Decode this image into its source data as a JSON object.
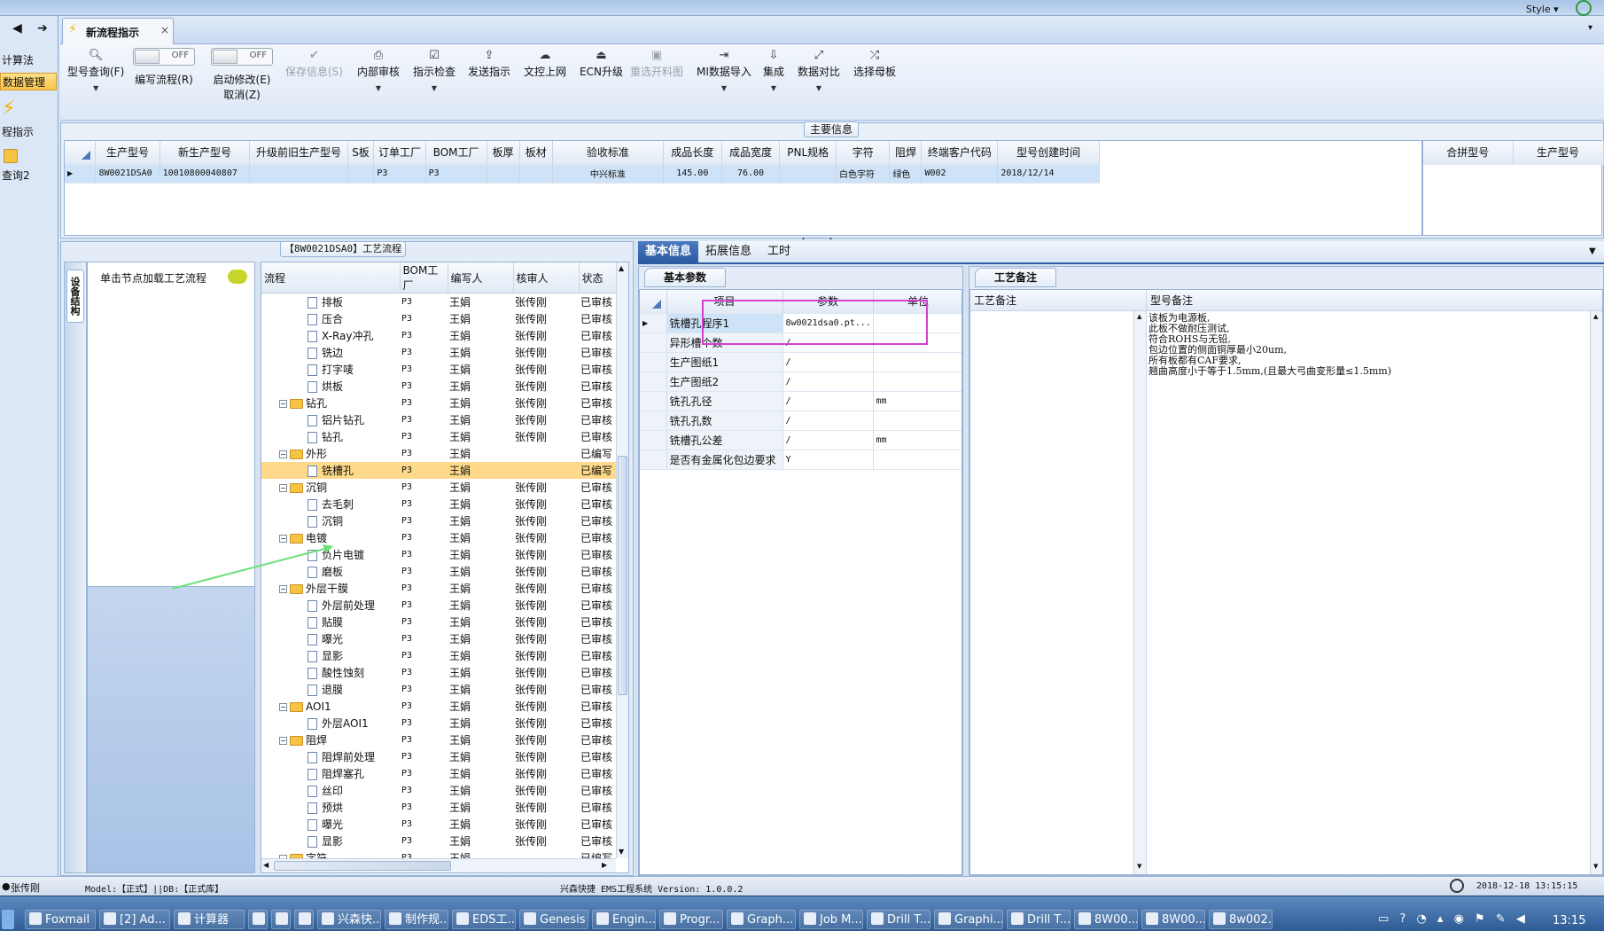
{
  "topbar": {
    "style_label": "Style ▾"
  },
  "left_nav": {
    "items": [
      {
        "label": "计算法",
        "selected": false
      },
      {
        "label": "数据管理",
        "selected": true
      },
      {
        "label": "程指示",
        "selected": false
      },
      {
        "label": "查询2",
        "selected": false
      }
    ]
  },
  "tabs": {
    "back_glyph": "◀",
    "forward_glyph": "➔",
    "active_label": "新流程指示",
    "close_glyph": "×",
    "menu_glyph": "▾"
  },
  "toolbar": {
    "buttons": [
      {
        "label": "型号查询(F)",
        "icon": "search-icon",
        "glyph": "🔍︎",
        "disabled": false,
        "dropdown": true
      },
      {
        "label": "编写流程(R)",
        "icon": "toggle-switch",
        "toggle": "OFF",
        "disabled": false
      },
      {
        "label": "启动修改(E)",
        "label2": "取消(Z)",
        "icon": "toggle-switch",
        "toggle": "OFF",
        "disabled": false
      },
      {
        "label": "保存信息(S)",
        "icon": "check-icon",
        "glyph": "✔",
        "disabled": true
      },
      {
        "label": "内部审核",
        "icon": "printer-icon",
        "glyph": "⎙",
        "disabled": false,
        "dropdown": true
      },
      {
        "label": "指示检查",
        "icon": "checkbox-icon",
        "glyph": "☑",
        "disabled": false,
        "dropdown": true
      },
      {
        "label": "发送指示",
        "icon": "upload-icon",
        "glyph": "⇪",
        "disabled": false
      },
      {
        "label": "文控上网",
        "icon": "cloud-icon",
        "glyph": "☁",
        "disabled": false
      },
      {
        "label": "ECN升级",
        "icon": "ecn-icon",
        "glyph": "⏏",
        "disabled": false
      },
      {
        "label": "重选开料图",
        "icon": "image-icon",
        "glyph": "▣",
        "disabled": true
      },
      {
        "label": "MI数据导入",
        "icon": "import-icon",
        "glyph": "⇥",
        "disabled": false,
        "dropdown": true
      },
      {
        "label": "集成",
        "icon": "download-icon",
        "glyph": "⇩",
        "disabled": false,
        "dropdown": true
      },
      {
        "label": "数据对比",
        "icon": "compare-icon",
        "glyph": "⤢",
        "disabled": false,
        "dropdown": true
      },
      {
        "label": "选择母板",
        "icon": "shuffle-icon",
        "glyph": "⤮",
        "disabled": false
      }
    ]
  },
  "main_info": {
    "section_title": "主要信息",
    "columns": [
      "生产型号",
      "新生产型号",
      "升级前旧生产型号",
      "S板",
      "订单工厂",
      "BOM工厂",
      "板厚",
      "板材",
      "验收标准",
      "成品长度",
      "成品宽度",
      "PNL规格",
      "字符",
      "阻焊",
      "终端客户代码",
      "型号创建时间"
    ],
    "rows": [
      [
        "8W0021DSA0",
        "10010800040807",
        "",
        "",
        "P3",
        "P3",
        "",
        "",
        "中兴标准",
        "145.00",
        "76.00",
        "",
        "白色字符",
        "绿色",
        "W002",
        "2018/12/14"
      ]
    ],
    "side_columns": [
      "合拼型号",
      "生产型号"
    ]
  },
  "process": {
    "section_title": "【8W0021DSA0】工艺流程",
    "side_tab_label": "设备结构",
    "hint": "单击节点加载工艺流程",
    "columns": [
      "流程",
      "BOM工厂",
      "编写人",
      "核审人",
      "状态"
    ],
    "rows": [
      {
        "name": "排板",
        "level": 2,
        "bom": "P3",
        "writer": "王娟",
        "reviewer": "张传刚",
        "status": "已审核"
      },
      {
        "name": "压合",
        "level": 2,
        "bom": "P3",
        "writer": "王娟",
        "reviewer": "张传刚",
        "status": "已审核"
      },
      {
        "name": "X-Ray冲孔",
        "level": 2,
        "bom": "P3",
        "writer": "王娟",
        "reviewer": "张传刚",
        "status": "已审核"
      },
      {
        "name": "铣边",
        "level": 2,
        "bom": "P3",
        "writer": "王娟",
        "reviewer": "张传刚",
        "status": "已审核"
      },
      {
        "name": "打字唛",
        "level": 2,
        "bom": "P3",
        "writer": "王娟",
        "reviewer": "张传刚",
        "status": "已审核"
      },
      {
        "name": "烘板",
        "level": 2,
        "bom": "P3",
        "writer": "王娟",
        "reviewer": "张传刚",
        "status": "已审核"
      },
      {
        "name": "钻孔",
        "level": 1,
        "bom": "P3",
        "writer": "王娟",
        "reviewer": "张传刚",
        "status": "已审核"
      },
      {
        "name": "铝片钻孔",
        "level": 2,
        "bom": "P3",
        "writer": "王娟",
        "reviewer": "张传刚",
        "status": "已审核"
      },
      {
        "name": "钻孔",
        "level": 2,
        "bom": "P3",
        "writer": "王娟",
        "reviewer": "张传刚",
        "status": "已审核"
      },
      {
        "name": "外形",
        "level": 1,
        "bom": "P3",
        "writer": "王娟",
        "reviewer": "",
        "status": "已编写"
      },
      {
        "name": "铣槽孔",
        "level": 2,
        "bom": "P3",
        "writer": "王娟",
        "reviewer": "",
        "status": "已编写",
        "selected": true
      },
      {
        "name": "沉铜",
        "level": 1,
        "bom": "P3",
        "writer": "王娟",
        "reviewer": "张传刚",
        "status": "已审核"
      },
      {
        "name": "去毛刺",
        "level": 2,
        "bom": "P3",
        "writer": "王娟",
        "reviewer": "张传刚",
        "status": "已审核"
      },
      {
        "name": "沉铜",
        "level": 2,
        "bom": "P3",
        "writer": "王娟",
        "reviewer": "张传刚",
        "status": "已审核"
      },
      {
        "name": "电镀",
        "level": 1,
        "bom": "P3",
        "writer": "王娟",
        "reviewer": "张传刚",
        "status": "已审核"
      },
      {
        "name": "负片电镀",
        "level": 2,
        "bom": "P3",
        "writer": "王娟",
        "reviewer": "张传刚",
        "status": "已审核"
      },
      {
        "name": "磨板",
        "level": 2,
        "bom": "P3",
        "writer": "王娟",
        "reviewer": "张传刚",
        "status": "已审核"
      },
      {
        "name": "外层干膜",
        "level": 1,
        "bom": "P3",
        "writer": "王娟",
        "reviewer": "张传刚",
        "status": "已审核"
      },
      {
        "name": "外层前处理",
        "level": 2,
        "bom": "P3",
        "writer": "王娟",
        "reviewer": "张传刚",
        "status": "已审核"
      },
      {
        "name": "贴膜",
        "level": 2,
        "bom": "P3",
        "writer": "王娟",
        "reviewer": "张传刚",
        "status": "已审核"
      },
      {
        "name": "曝光",
        "level": 2,
        "bom": "P3",
        "writer": "王娟",
        "reviewer": "张传刚",
        "status": "已审核"
      },
      {
        "name": "显影",
        "level": 2,
        "bom": "P3",
        "writer": "王娟",
        "reviewer": "张传刚",
        "status": "已审核"
      },
      {
        "name": "酸性蚀刻",
        "level": 2,
        "bom": "P3",
        "writer": "王娟",
        "reviewer": "张传刚",
        "status": "已审核"
      },
      {
        "name": "退膜",
        "level": 2,
        "bom": "P3",
        "writer": "王娟",
        "reviewer": "张传刚",
        "status": "已审核"
      },
      {
        "name": "AOI1",
        "level": 1,
        "bom": "P3",
        "writer": "王娟",
        "reviewer": "张传刚",
        "status": "已审核"
      },
      {
        "name": "外层AOI1",
        "level": 2,
        "bom": "P3",
        "writer": "王娟",
        "reviewer": "张传刚",
        "status": "已审核"
      },
      {
        "name": "阻焊",
        "level": 1,
        "bom": "P3",
        "writer": "王娟",
        "reviewer": "张传刚",
        "status": "已审核"
      },
      {
        "name": "阻焊前处理",
        "level": 2,
        "bom": "P3",
        "writer": "王娟",
        "reviewer": "张传刚",
        "status": "已审核"
      },
      {
        "name": "阻焊塞孔",
        "level": 2,
        "bom": "P3",
        "writer": "王娟",
        "reviewer": "张传刚",
        "status": "已审核"
      },
      {
        "name": "丝印",
        "level": 2,
        "bom": "P3",
        "writer": "王娟",
        "reviewer": "张传刚",
        "status": "已审核"
      },
      {
        "name": "预烘",
        "level": 2,
        "bom": "P3",
        "writer": "王娟",
        "reviewer": "张传刚",
        "status": "已审核"
      },
      {
        "name": "曝光",
        "level": 2,
        "bom": "P3",
        "writer": "王娟",
        "reviewer": "张传刚",
        "status": "已审核"
      },
      {
        "name": "显影",
        "level": 2,
        "bom": "P3",
        "writer": "王娟",
        "reviewer": "张传刚",
        "status": "已审核"
      },
      {
        "name": "字符",
        "level": 1,
        "bom": "P3",
        "writer": "王娟",
        "reviewer": "",
        "status": "已编写"
      }
    ]
  },
  "detail": {
    "tabs": [
      "基本信息",
      "拓展信息",
      "工时"
    ],
    "active_tab": 0,
    "params_title": "基本参数",
    "params_columns": [
      "项目",
      "参数",
      "单位"
    ],
    "params_rows": [
      {
        "item": "铣槽孔程序1",
        "value": "8w0021dsa0.pt...",
        "unit": ""
      },
      {
        "item": "异形槽个数",
        "value": "/",
        "unit": ""
      },
      {
        "item": "生产图纸1",
        "value": "/",
        "unit": ""
      },
      {
        "item": "生产图纸2",
        "value": "/",
        "unit": ""
      },
      {
        "item": "铣孔孔径",
        "value": "/",
        "unit": "mm"
      },
      {
        "item": "铣孔孔数",
        "value": "/",
        "unit": ""
      },
      {
        "item": "铣槽孔公差",
        "value": "/",
        "unit": "mm"
      },
      {
        "item": "是否有金属化包边要求",
        "value": "Y",
        "unit": ""
      }
    ],
    "remarks_title": "工艺备注",
    "remarks_columns": [
      "工艺备注",
      "型号备注"
    ],
    "model_remarks": [
      "该板为电源板,",
      "此板不做耐压测试,",
      "符合ROHS与无铅,",
      "包边位置的侧面铜厚最小20um,",
      "所有板都有CAF要求,",
      "翘曲高度小于等于1.5mm,(且最大弓曲变形量≤1.5mm)"
    ]
  },
  "statusbar": {
    "user": "张传刚",
    "model": "Model:【正式】||DB:【正式库】",
    "app": "兴森快捷 EMS工程系统 Version: 1.0.0.2",
    "datetime": "2018-12-18 13:15:15"
  },
  "taskbar": {
    "items": [
      "Foxmail",
      "[2] Ad...",
      "计算器",
      "",
      "",
      "",
      "兴森快...",
      "制作规...",
      "EDS工...",
      "Genesis",
      "Engin...",
      "Progr...",
      "Graph...",
      "Job M...",
      "Drill T...",
      "Graphi...",
      "Drill T...",
      "8W00...",
      "8W00...",
      "8w002..."
    ],
    "clock": "13:15"
  },
  "colors": {
    "accent": "#2d5aa0",
    "selected_row": "#fbe7a2",
    "highlight_box": "#d63fd6",
    "arrow": "#6ee07a"
  }
}
